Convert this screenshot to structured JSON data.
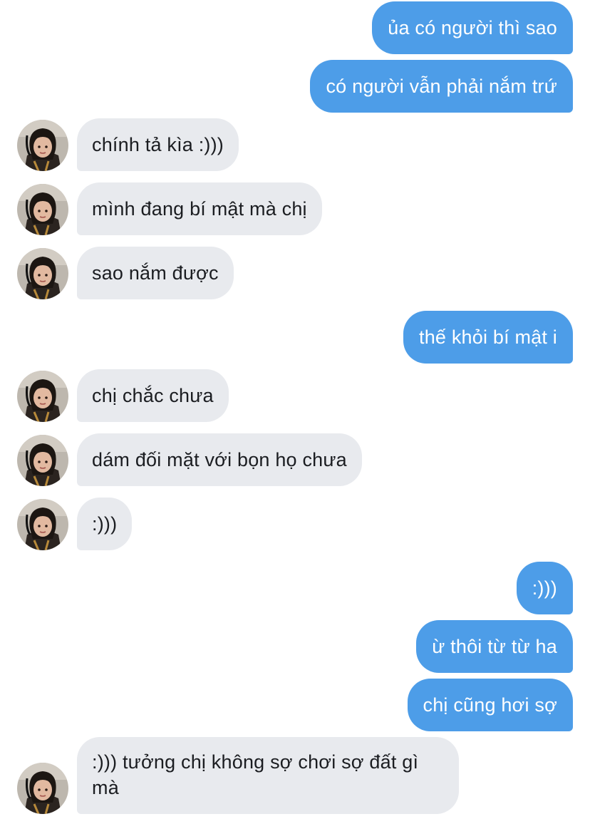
{
  "messages": [
    {
      "side": "out",
      "text": "ủa có người thì sao"
    },
    {
      "side": "out",
      "text": "có người vẫn phải nắm trứ"
    },
    {
      "side": "in",
      "text": "chính tả kìa :)))"
    },
    {
      "side": "in",
      "text": "mình đang bí mật mà chị"
    },
    {
      "side": "in",
      "text": "sao nắm được"
    },
    {
      "side": "out",
      "text": "thế khỏi bí mật i"
    },
    {
      "side": "in",
      "text": "chị chắc chưa"
    },
    {
      "side": "in",
      "text": "dám đối mặt với bọn họ chưa"
    },
    {
      "side": "in",
      "text": ":)))"
    },
    {
      "side": "out",
      "text": ":)))"
    },
    {
      "side": "out",
      "text": "ừ thôi từ từ ha"
    },
    {
      "side": "out",
      "text": "chị cũng hơi sợ"
    },
    {
      "side": "in",
      "text": ":))) tưởng chị không sợ chơi sợ đất gì mà"
    }
  ],
  "colors": {
    "outgoing_bubble": "#4d9de8",
    "incoming_bubble": "#e8eaee",
    "incoming_text": "#1b1d21",
    "outgoing_text": "#ffffff"
  },
  "avatar_icon": "contact-photo"
}
